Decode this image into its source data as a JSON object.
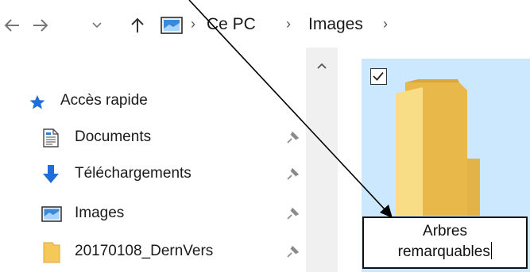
{
  "address_bar": {
    "back_icon": "arrow-left-icon",
    "forward_icon": "arrow-right-icon",
    "recent_icon": "chevron-down-icon",
    "up_icon": "arrow-up-icon",
    "location_icon": "pc-display-icon",
    "separator": "›",
    "breadcrumbs": [
      "Ce PC",
      "Images"
    ]
  },
  "nav_pane": {
    "quick_access": {
      "label": "Accès rapide",
      "icon": "star-icon",
      "color": "#1e6fd9"
    },
    "items": [
      {
        "label": "Documents",
        "icon": "document-icon",
        "pinned": true
      },
      {
        "label": "Téléchargements",
        "icon": "download-arrow-icon",
        "pinned": true
      },
      {
        "label": "Images",
        "icon": "pictures-icon",
        "pinned": true
      },
      {
        "label": "20170108_DernVers",
        "icon": "folder-icon",
        "pinned": true
      }
    ],
    "pin_icon": "pin-icon"
  },
  "scrollbar": {
    "up_icon": "chevron-up-icon"
  },
  "content": {
    "selected_folder": {
      "checked": true,
      "icon": "folder-icon",
      "rename_line1": "Arbres",
      "rename_line2": "remarquables",
      "selection_color": "#cce8ff",
      "folder_color": "#f5c85a"
    }
  },
  "annotation": {
    "type": "arrow",
    "color": "#000000"
  }
}
